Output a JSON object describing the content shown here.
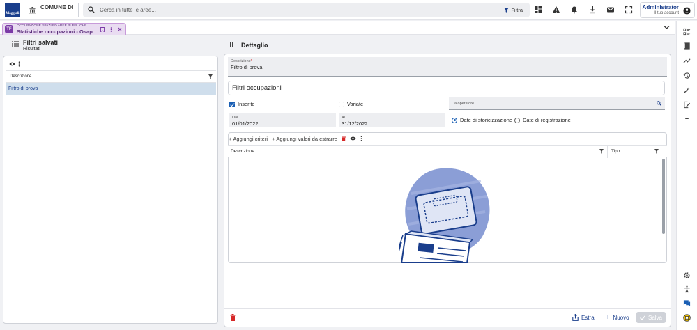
{
  "header": {
    "logo_text": "Maggioli",
    "municipality": "COMUNE DI",
    "search_placeholder": "Cerca in tutte le aree...",
    "filter_label": "Filtra",
    "user_name": "Administrator",
    "user_sub": "Il tuo account"
  },
  "app_tab": {
    "badge": "TF",
    "area": "OCCUPAZIONE SPAZI ED AREE PUBBLICHE",
    "title": "Statistiche occupazioni - Osap"
  },
  "left_panel": {
    "title": "Filtri salvati",
    "subtitle": "Risultati",
    "column_header": "Descrizione",
    "rows": [
      "Filtro di prova"
    ]
  },
  "right_panel": {
    "title": "Dettaglio",
    "description_label": "Descrizione",
    "description_value": "Filtro di prova",
    "card_title": "Filtri occupazioni",
    "checkbox_inserite": "Inserite",
    "checkbox_variate": "Variate",
    "operator_placeholder": "Da operatore",
    "date_from_label": "Dal",
    "date_from": "01/01/2022",
    "date_to_label": "Al",
    "date_to": "31/12/2022",
    "radio_storicizzazione": "Date di storicizzazione",
    "radio_registrazione": "Date di registrazione",
    "add_criteria": "Aggiungi criteri",
    "add_values": "Aggiungi valori da estrarre",
    "grid_col_description": "Descrizione",
    "grid_col_type": "Tipo",
    "btn_extract": "Estrai",
    "btn_new": "Nuovo",
    "btn_save": "Salva"
  },
  "colors": {
    "brand": "#1a3e8c",
    "accent": "#1a5fb4",
    "tab_purple": "#7b3aa6",
    "selection": "#cfdeec",
    "danger": "#d62828"
  }
}
